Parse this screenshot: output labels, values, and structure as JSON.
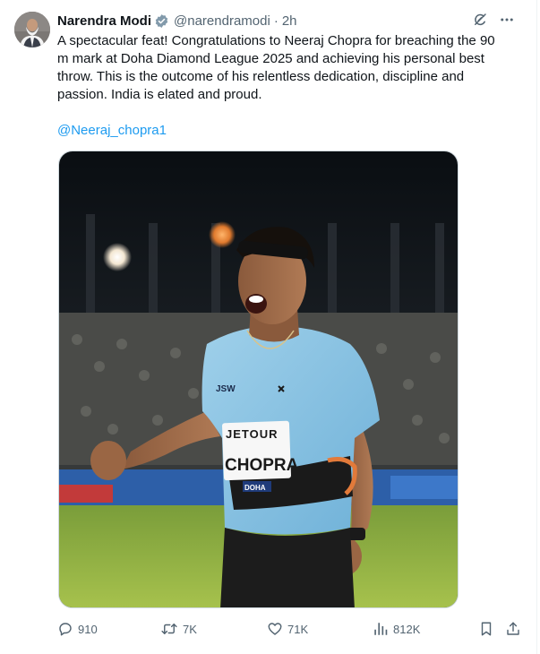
{
  "author": {
    "name": "Narendra Modi",
    "handle": "@narendramodi",
    "separator": "·",
    "time": "2h",
    "avatar_icon": "profile-photo"
  },
  "tweet": {
    "text": "A spectacular feat! Congratulations to Neeraj Chopra for breaching the 90 m mark at Doha Diamond League 2025 and achieving his personal best throw. This is the outcome of his relentless dedication, discipline and passion. India is elated and proud.",
    "mention": "@Neeraj_chopra1"
  },
  "media": {
    "bib_sponsor": "JETOUR",
    "bib_name": "CHOPRA",
    "bib_location": "DOHA",
    "shirt_logo": "JSW"
  },
  "actions": {
    "replies": "910",
    "reposts": "7K",
    "likes": "71K",
    "views": "812K"
  },
  "colors": {
    "accent": "#1d9bf0",
    "muted": "#536471",
    "text": "#0f1419",
    "verified": "#829aab"
  },
  "icons": [
    "verified-badge-icon",
    "grok-icon",
    "more-icon",
    "reply-icon",
    "repost-icon",
    "like-icon",
    "views-icon",
    "bookmark-icon",
    "share-icon"
  ]
}
